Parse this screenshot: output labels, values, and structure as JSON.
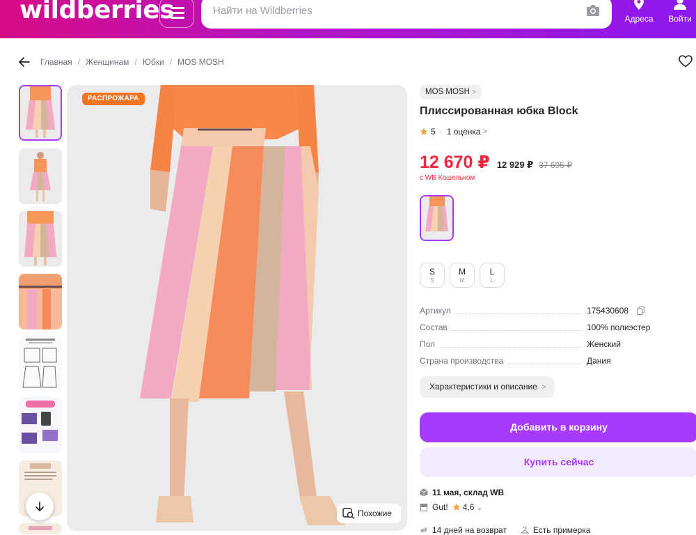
{
  "header": {
    "logo": "wildberries",
    "search_placeholder": "Найти на Wildberries",
    "addresses_label": "Адреса",
    "login_label": "Войти",
    "brand_gradient": [
      "#d70b86",
      "#8d19f0"
    ]
  },
  "breadcrumbs": [
    "Главная",
    "Женщинам",
    "Юбки",
    "MOS MOSH"
  ],
  "gallery": {
    "badge": "РАСПРОЖАРА",
    "similar_label": "Похожие",
    "thumbnail_count": 8,
    "active_thumbnail": 1
  },
  "product": {
    "brand": "MOS MOSH",
    "title": "Плиссированная юбка Block",
    "rating": "5",
    "reviews": "1 оценка",
    "price": "12 670 ₽",
    "price_without_wallet": "12 929 ₽",
    "old_price": "37 695 ₽",
    "wallet_note": "с WB Кошельком",
    "sizes": [
      {
        "label": "S",
        "sub": "S"
      },
      {
        "label": "M",
        "sub": "M"
      },
      {
        "label": "L",
        "sub": "L"
      }
    ],
    "specs": [
      {
        "key": "Артикул",
        "value": "175430608"
      },
      {
        "key": "Состав",
        "value": "100% полиэстер"
      },
      {
        "key": "Пол",
        "value": "Женский"
      },
      {
        "key": "Страна производства",
        "value": "Дания"
      }
    ],
    "characteristics_label": "Характеристики и описание",
    "add_to_cart_label": "Добавить в корзину",
    "buy_now_label": "Купить сейчас",
    "delivery": "11 мая, склад WB",
    "seller": "Gut!",
    "seller_rating": "4,6",
    "returns": "14 дней на возврат",
    "fitting": "Есть примерка"
  },
  "colors": {
    "accent": "#a73afd",
    "price_red": "#f1263f",
    "sale_orange": "#f2741f"
  }
}
